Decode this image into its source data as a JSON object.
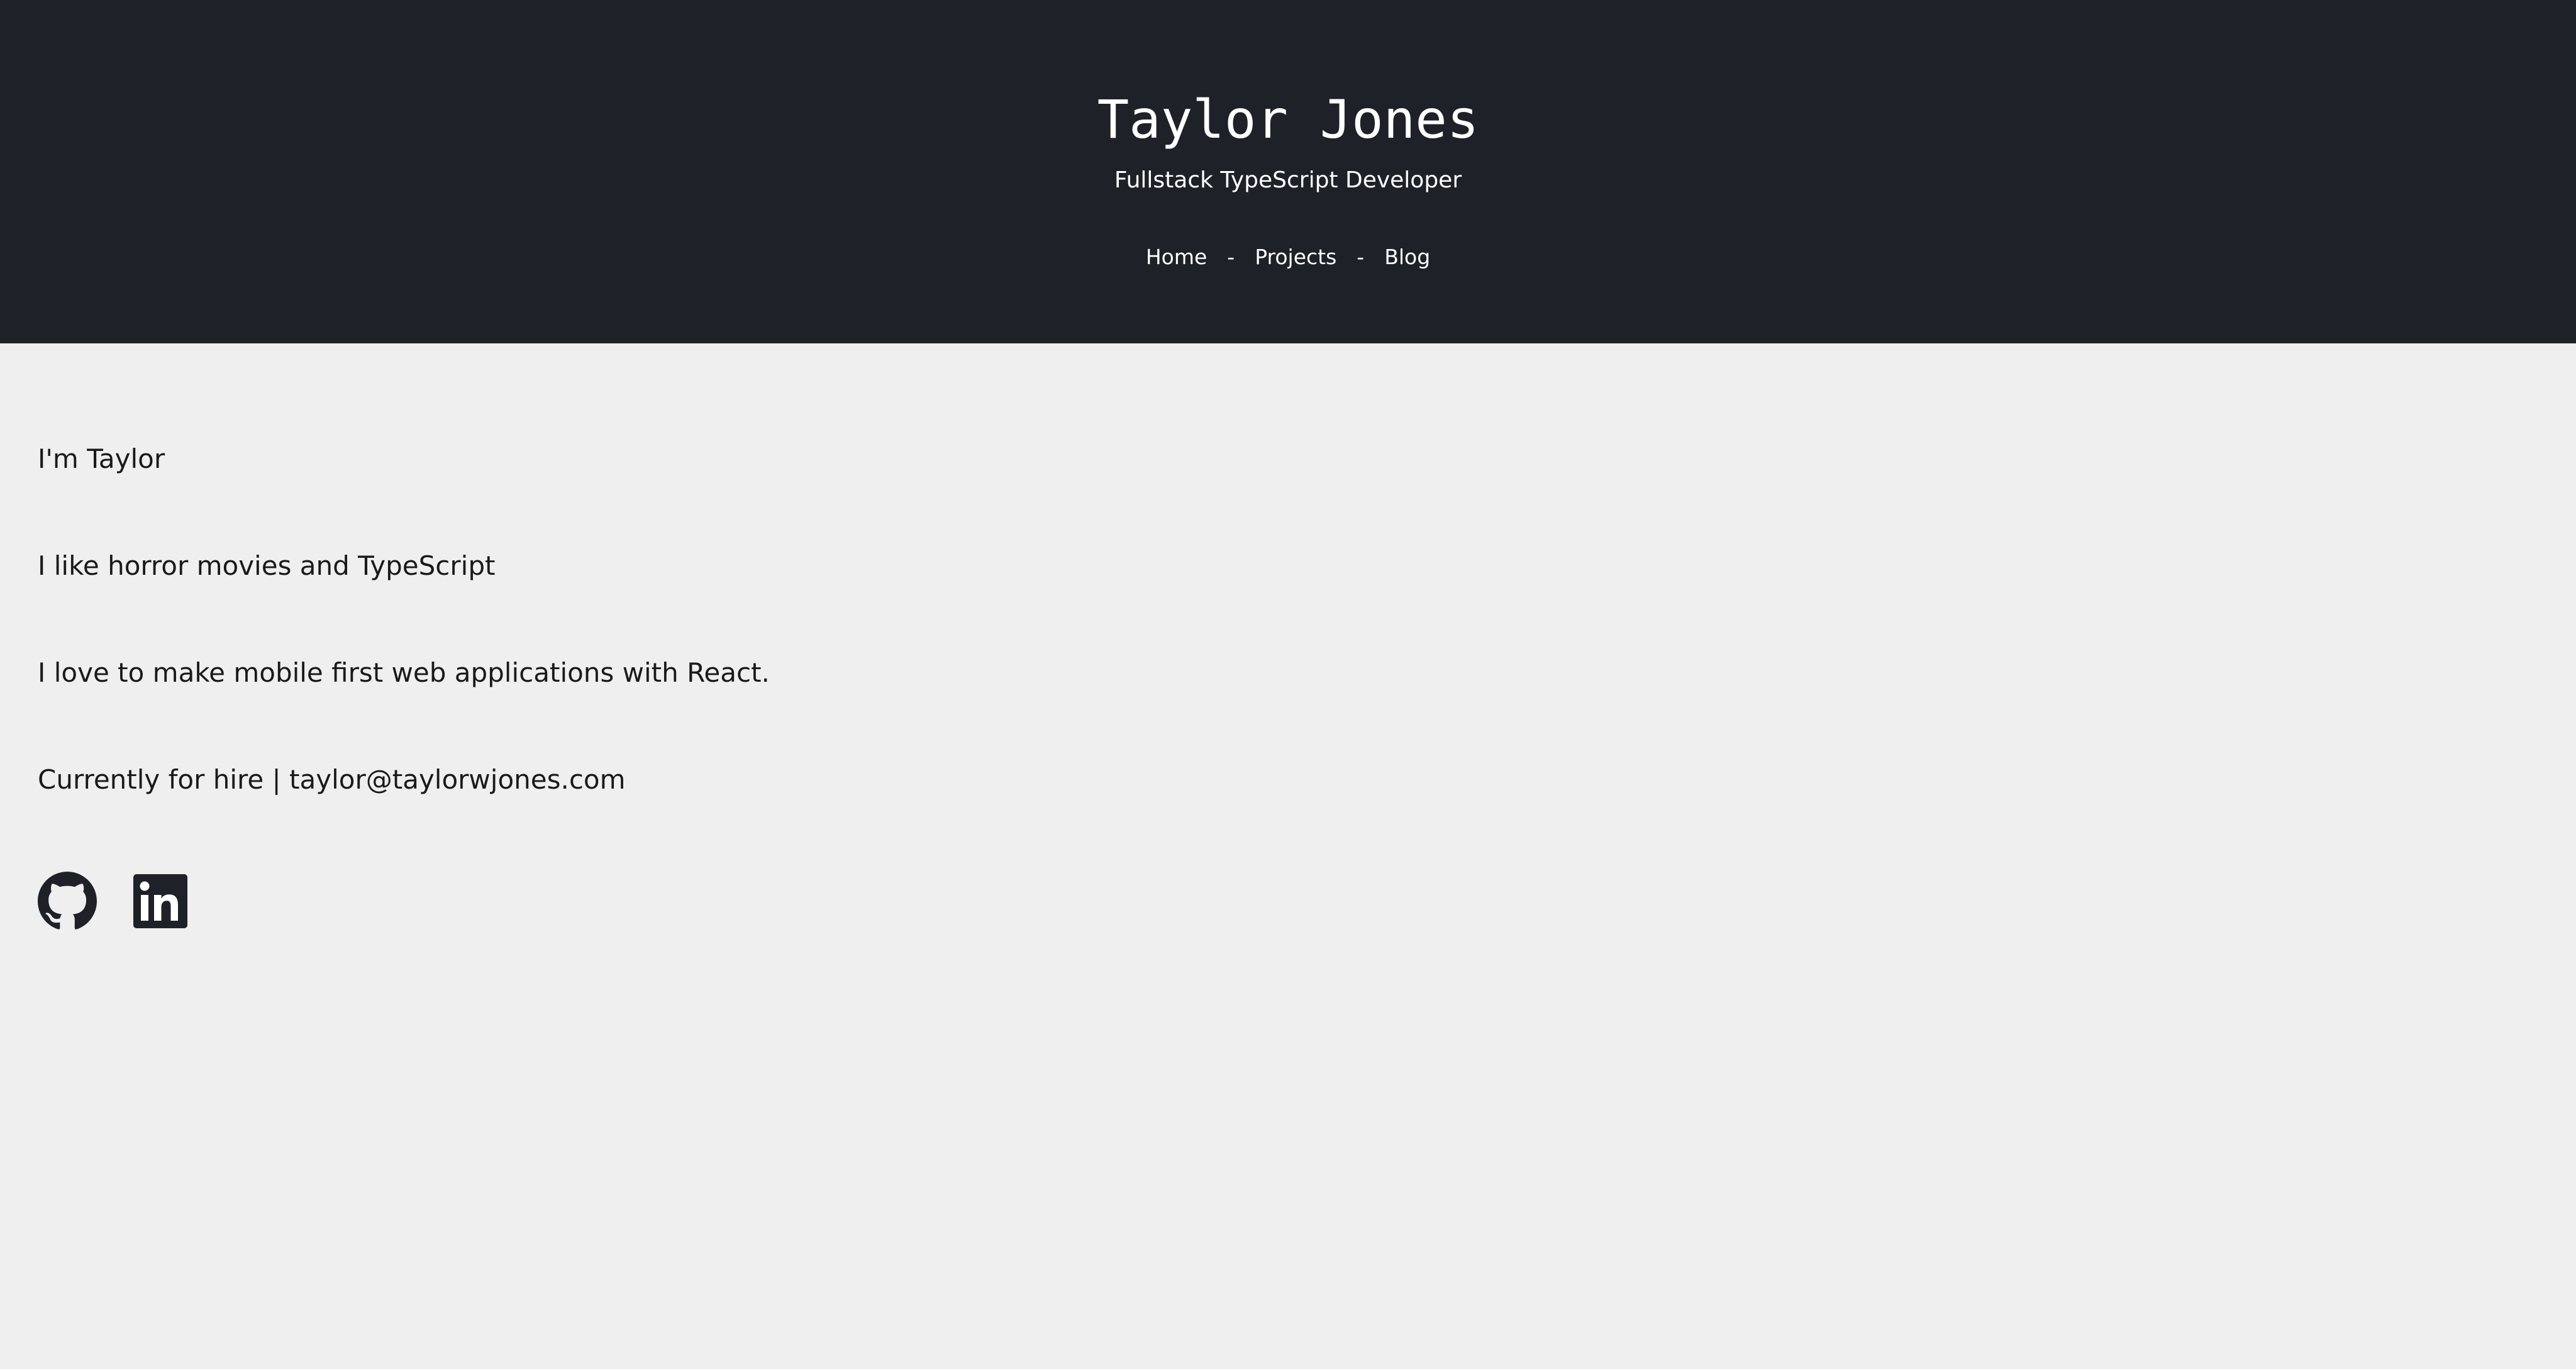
{
  "header": {
    "title": "Taylor Jones",
    "subtitle": "Fullstack TypeScript Developer",
    "nav": {
      "home": "Home",
      "projects": "Projects",
      "blog": "Blog",
      "separator": "-"
    }
  },
  "about": {
    "intro": "I'm Taylor",
    "interests": "I like horror movies and TypeScript",
    "passion": "I love to make mobile first web applications with React.",
    "hire": "Currently for hire | taylor@taylorwjones.com"
  },
  "social": {
    "icons": [
      "github-icon",
      "linkedin-icon"
    ]
  },
  "colors": {
    "header_bg": "#1e2128",
    "page_bg": "#efefef",
    "text": "#1a1a1a",
    "icon": "#1e2128"
  }
}
